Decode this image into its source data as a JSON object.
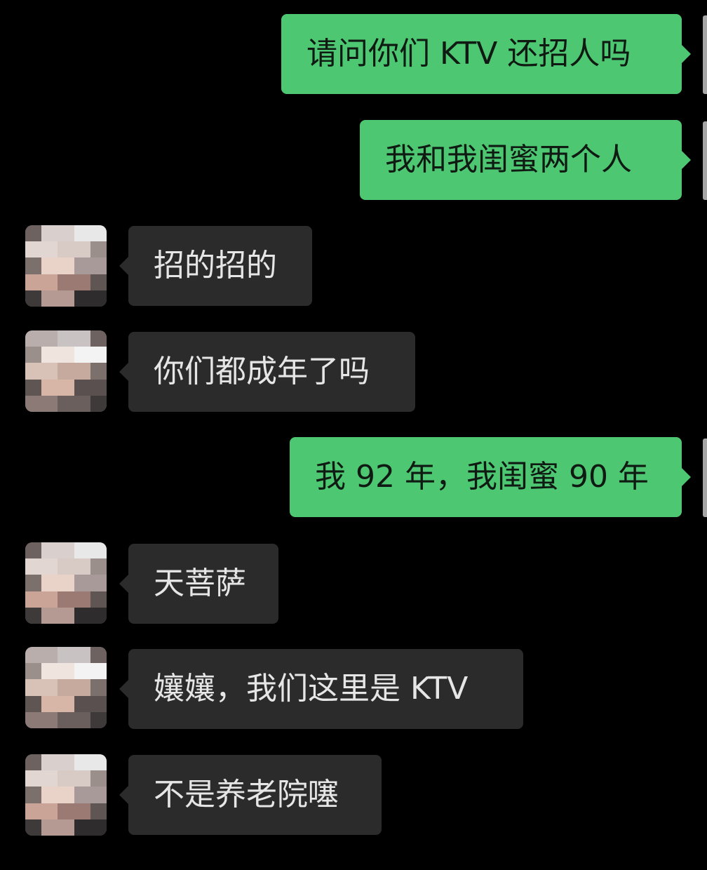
{
  "chat": {
    "messages": [
      {
        "side": "out",
        "text": "请问你们 KTV 还招人吗"
      },
      {
        "side": "out",
        "text": "我和我闺蜜两个人"
      },
      {
        "side": "in",
        "text": "招的招的"
      },
      {
        "side": "in",
        "text": "你们都成年了吗"
      },
      {
        "side": "out",
        "text": "我 92 年，我闺蜜 90 年"
      },
      {
        "side": "in",
        "text": "天菩萨"
      },
      {
        "side": "in",
        "text": "孃孃，我们这里是 KTV"
      },
      {
        "side": "in",
        "text": "不是养老院噻"
      }
    ]
  },
  "colors": {
    "background": "#000000",
    "outgoing_bubble": "#4ec772",
    "incoming_bubble": "#2b2b2b",
    "incoming_text": "#e6e6e6",
    "outgoing_text": "#0f1a12"
  },
  "icons": {
    "contact_avatar": "pixelated-avatar"
  }
}
